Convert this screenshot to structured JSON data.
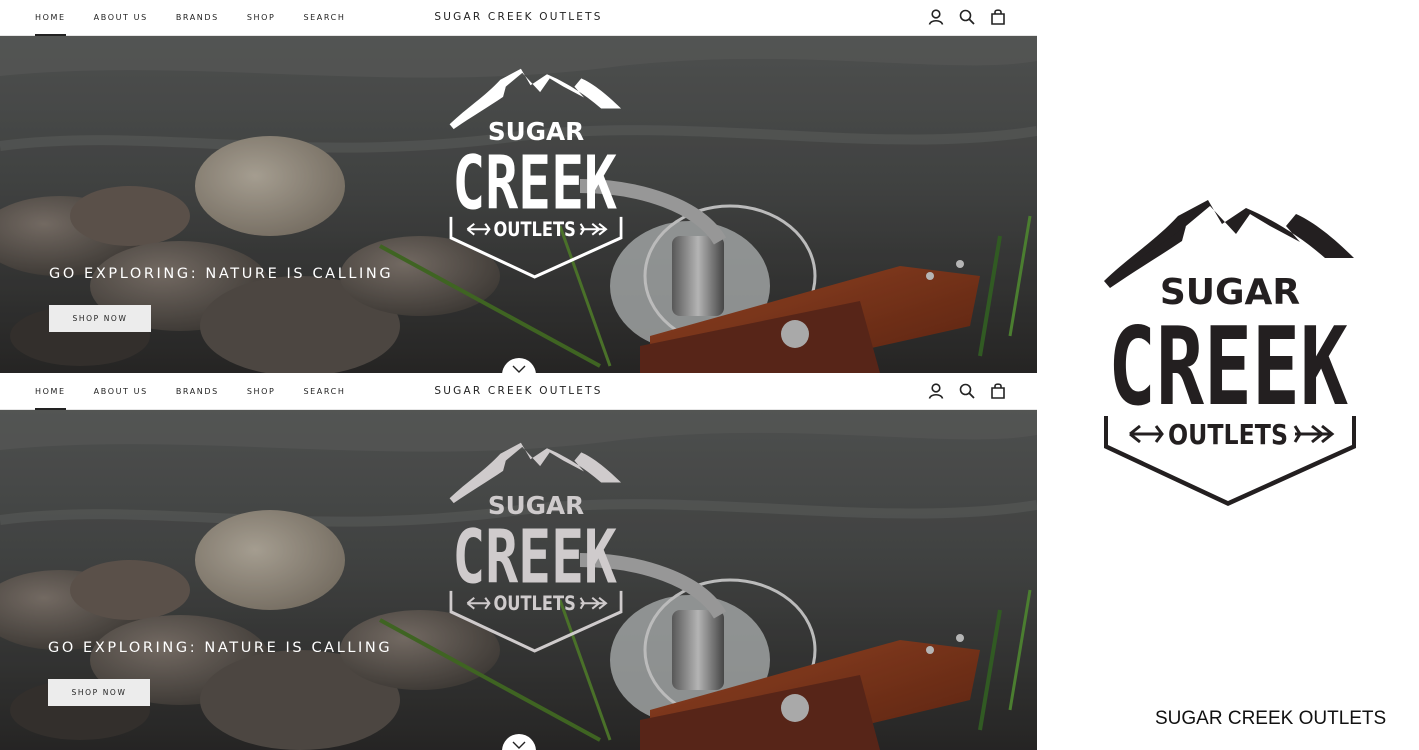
{
  "site": {
    "title": "SUGAR CREEK OUTLETS"
  },
  "nav": {
    "items": [
      {
        "label": "HOME",
        "active": true
      },
      {
        "label": "ABOUT US",
        "active": false
      },
      {
        "label": "BRANDS",
        "active": false
      },
      {
        "label": "SHOP",
        "active": false
      },
      {
        "label": "SEARCH",
        "active": false
      }
    ],
    "icons": [
      "account-icon",
      "search-icon",
      "bag-icon"
    ]
  },
  "hero": {
    "heading": "GO EXPLORING: NATURE IS CALLING",
    "button_label": "SHOP NOW",
    "logo_text": {
      "line1": "SUGAR",
      "line2": "CREEK",
      "line3": "OUTLETS"
    },
    "logo_color_top": "#ffffff",
    "logo_color_bottom": "#cfcbcc"
  },
  "side": {
    "caption": "SUGAR CREEK OUTLETS",
    "logo_color": "#231f20"
  },
  "colors": {
    "nav_bg": "#ffffff",
    "button_bg": "#ececec",
    "text_dark": "#222222",
    "wood": "#8b3a1e"
  }
}
